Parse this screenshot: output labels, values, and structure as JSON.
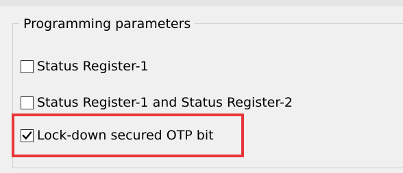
{
  "group": {
    "title": "Programming parameters"
  },
  "options": [
    {
      "label": "Status Register-1",
      "checked": false
    },
    {
      "label": "Status Register-1 and Status Register-2",
      "checked": false
    },
    {
      "label": "Lock-down secured OTP bit",
      "checked": true
    }
  ],
  "colors": {
    "highlight": "#e8353a",
    "window_bg": "#f0f0f0",
    "checkbox_border": "#333333"
  },
  "icons": {
    "checkmark": "checkmark-icon"
  }
}
